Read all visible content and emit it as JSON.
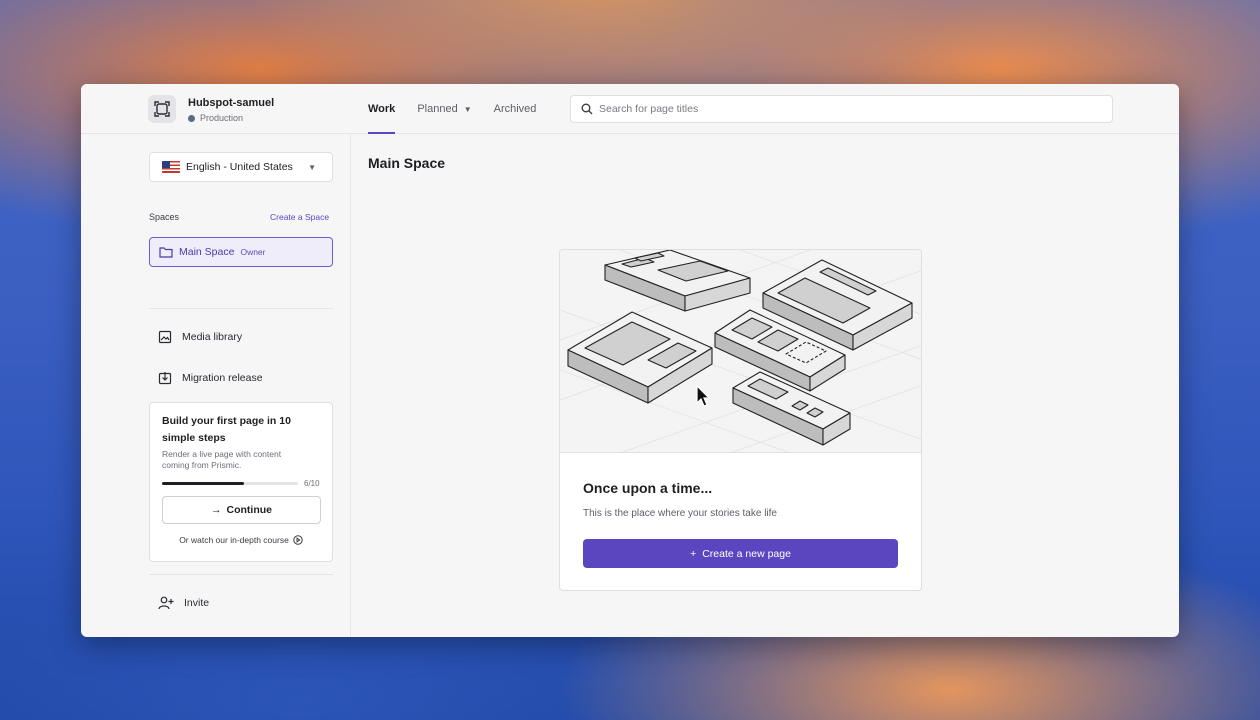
{
  "repository": {
    "name": "Hubspot-samuel",
    "environment": "Production"
  },
  "tabs": [
    {
      "label": "Work",
      "active": true
    },
    {
      "label": "Planned",
      "active": false,
      "has_dropdown": true
    },
    {
      "label": "Archived",
      "active": false
    }
  ],
  "search": {
    "placeholder": "Search for page titles",
    "value": ""
  },
  "sidebar": {
    "locale": "English - United States",
    "spaces_label": "Spaces",
    "create_space": "Create a Space",
    "space": {
      "name": "Main Space",
      "role": "Owner"
    },
    "nav": [
      {
        "label": "Media library",
        "icon": "image-icon"
      },
      {
        "label": "Migration release",
        "icon": "migration-icon"
      }
    ],
    "onboarding": {
      "title": "Build your first page in 10 simple steps",
      "description": "Render a live page with content coming from Prismic.",
      "progress_text": "6/10",
      "progress": 0.6,
      "continue_label": "Continue",
      "course_link": "Or watch our in-depth course"
    },
    "invite": "Invite"
  },
  "main": {
    "title": "Main Space",
    "empty_state": {
      "title": "Once upon a time...",
      "description": "This is the place where your stories take life",
      "button": "Create a new page"
    }
  },
  "colors": {
    "accent": "#5b46c0",
    "accent_light": "#efedfa"
  }
}
